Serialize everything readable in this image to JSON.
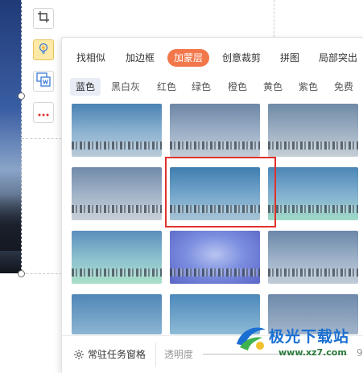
{
  "tabs": [
    "找相似",
    "加边框",
    "加蒙层",
    "创意裁剪",
    "拼图",
    "局部突出"
  ],
  "active_tab": "加蒙层",
  "color_tabs": [
    "蓝色",
    "黑白灰",
    "红色",
    "绿色",
    "橙色",
    "黄色",
    "紫色",
    "免费"
  ],
  "active_color_tab": "蓝色",
  "footer": {
    "pin_label": "常驻任务窗格",
    "opacity_label": "透明度",
    "opacity_value": "9"
  },
  "watermark": {
    "brand": "极光下载站",
    "url": "www.xz7.com"
  },
  "colors": {
    "accent": "#f2774b",
    "selection": "#e0322c",
    "subtab_active_bg": "#e7ecf5"
  },
  "icons": [
    "crop-icon",
    "lightbulb-icon",
    "picture-in-picture-icon",
    "more-icon",
    "gear-icon"
  ],
  "selected_thumbnail": "row 2, column 2"
}
